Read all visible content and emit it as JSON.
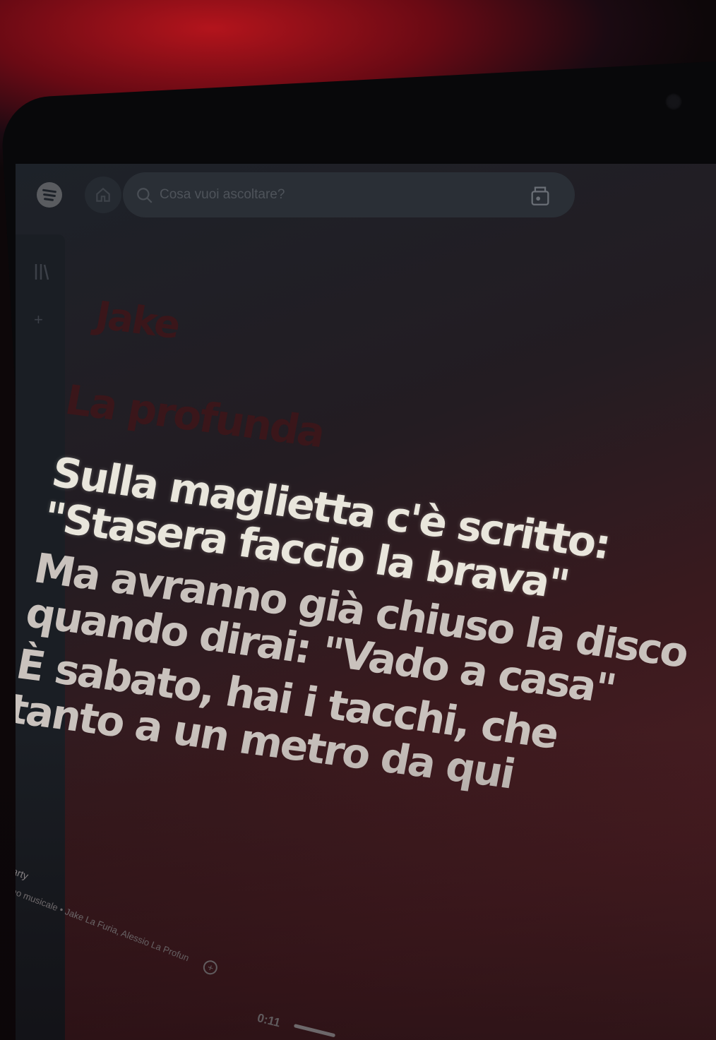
{
  "search": {
    "placeholder": "Cosa vuoi ascoltare?"
  },
  "icons": {
    "logo": "spotify-logo",
    "home": "home-icon",
    "search": "search-icon",
    "browse": "browse-icon",
    "library": "library-icon",
    "add": "add-circle-icon"
  },
  "lyrics": {
    "past": [
      "Jake",
      "La profunda"
    ],
    "active": [
      "Sulla maglietta c'è scritto:",
      "\"Stasera faccio la brava\""
    ],
    "upcoming": [
      "Ma avranno già chiuso la disco",
      "quando dirai: \"Vado a casa\"",
      "È sabato, hai i tacchi, che",
      "tanto a un metro da qui"
    ]
  },
  "now_playing": {
    "title": "Party",
    "meta": "Video musicale • Jake La Furia, Alessio La Profun"
  },
  "player": {
    "time": "0:11",
    "progress": 0.05
  },
  "colors": {
    "active_lyric": "#e9e6dc",
    "past_lyric": "#3a161a",
    "upcoming_lyric": "#c9c2bd",
    "ambient_red": "#b3141c"
  }
}
